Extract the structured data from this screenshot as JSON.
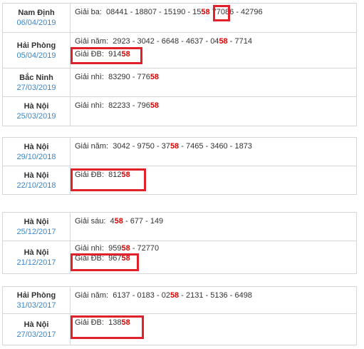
{
  "highlight_color": "#e0202a",
  "number_color": "#e00000",
  "tables": [
    {
      "rows": [
        {
          "province": "Nam Định",
          "date": "06/04/2019",
          "lines": [
            {
              "label": "Giải ba:",
              "pre": "08441 - 18807 - 15190 - 15",
              "hit": "58",
              "post": " 77086 - 42796"
            }
          ]
        },
        {
          "province": "Hải Phòng",
          "date": "05/04/2019",
          "lines": [
            {
              "label": "Giải năm:",
              "pre": "2923 - 3042 - 6648 - 4637 - 04",
              "hit": "58",
              "post": " - 7714"
            },
            {
              "label": "Giải ĐB:",
              "pre": "914",
              "hit": "58",
              "post": ""
            }
          ]
        },
        {
          "province": "Bắc Ninh",
          "date": "27/03/2019",
          "lines": [
            {
              "label": "Giải nhì:",
              "pre": "83290 - 776",
              "hit": "58",
              "post": ""
            }
          ]
        },
        {
          "province": "Hà Nội",
          "date": "25/03/2019",
          "lines": [
            {
              "label": "Giải nhì:",
              "pre": "82233 - 796",
              "hit": "58",
              "post": ""
            }
          ]
        }
      ]
    },
    {
      "rows": [
        {
          "province": "Hà Nội",
          "date": "29/10/2018",
          "lines": [
            {
              "label": "Giải năm:",
              "pre": "3042 - 9750 - 37",
              "hit": "58",
              "post": " - 7465 - 3460 - 1873"
            }
          ]
        },
        {
          "province": "Hà Nội",
          "date": "22/10/2018",
          "lines": [
            {
              "label": "Giải ĐB:",
              "pre": "812",
              "hit": "58",
              "post": ""
            }
          ]
        }
      ]
    },
    {
      "rows": [
        {
          "province": "Hà Nội",
          "date": "25/12/2017",
          "lines": [
            {
              "label": "Giải sáu:",
              "pre": "4",
              "hit": "58",
              "post": " - 677 - 149"
            }
          ]
        },
        {
          "province": "Hà Nội",
          "date": "21/12/2017",
          "lines": [
            {
              "label": "Giải nhì:",
              "pre": "959",
              "hit": "58",
              "post": " - 72770"
            },
            {
              "label": "Giải ĐB:",
              "pre": "967",
              "hit": "58",
              "post": ""
            }
          ]
        }
      ]
    },
    {
      "rows": [
        {
          "province": "Hải Phòng",
          "date": "31/03/2017",
          "lines": [
            {
              "label": "Giải năm:",
              "pre": "6137 - 0183 - 02",
              "hit": "58",
              "post": " - 2131 - 5136 - 6498"
            }
          ]
        },
        {
          "province": "Hà Nội",
          "date": "27/03/2017",
          "lines": [
            {
              "label": "Giải ĐB:",
              "pre": "138",
              "hit": "58",
              "post": ""
            }
          ]
        }
      ]
    }
  ]
}
